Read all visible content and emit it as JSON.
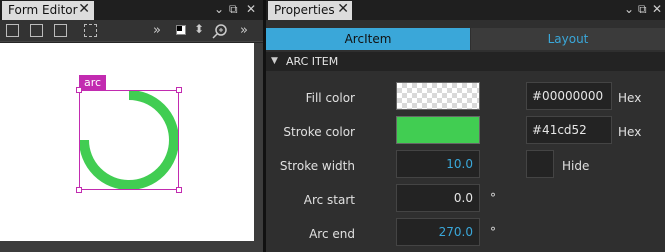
{
  "form_editor": {
    "tab_label": "Form Editor",
    "tab_close_glyph": "✕",
    "item_label": "arc",
    "chevron_glyph": "»"
  },
  "properties": {
    "tab_label": "Properties",
    "tab_close_glyph": "✕",
    "subtabs": [
      "ArcItem",
      "Layout"
    ],
    "section_title": "ARC ITEM",
    "fill_color": {
      "label": "Fill color",
      "hex": "#00000000",
      "hex_label": "Hex",
      "swatch": "transparent"
    },
    "stroke_color": {
      "label": "Stroke color",
      "hex": "#41cd52",
      "hex_label": "Hex",
      "swatch": "#41cd52"
    },
    "stroke_width": {
      "label": "Stroke width",
      "value": "10.0",
      "hide_label": "Hide"
    },
    "arc_start": {
      "label": "Arc start",
      "value": "0.0",
      "unit": "°"
    },
    "arc_end": {
      "label": "Arc end",
      "value": "270.0",
      "unit": "°"
    }
  },
  "window_icons": [
    "chevron-down-icon",
    "float-icon",
    "close-icon"
  ],
  "colors": {
    "accent": "#3aa7d9",
    "selection": "#c22bb0",
    "arc_stroke": "#41cd52"
  }
}
